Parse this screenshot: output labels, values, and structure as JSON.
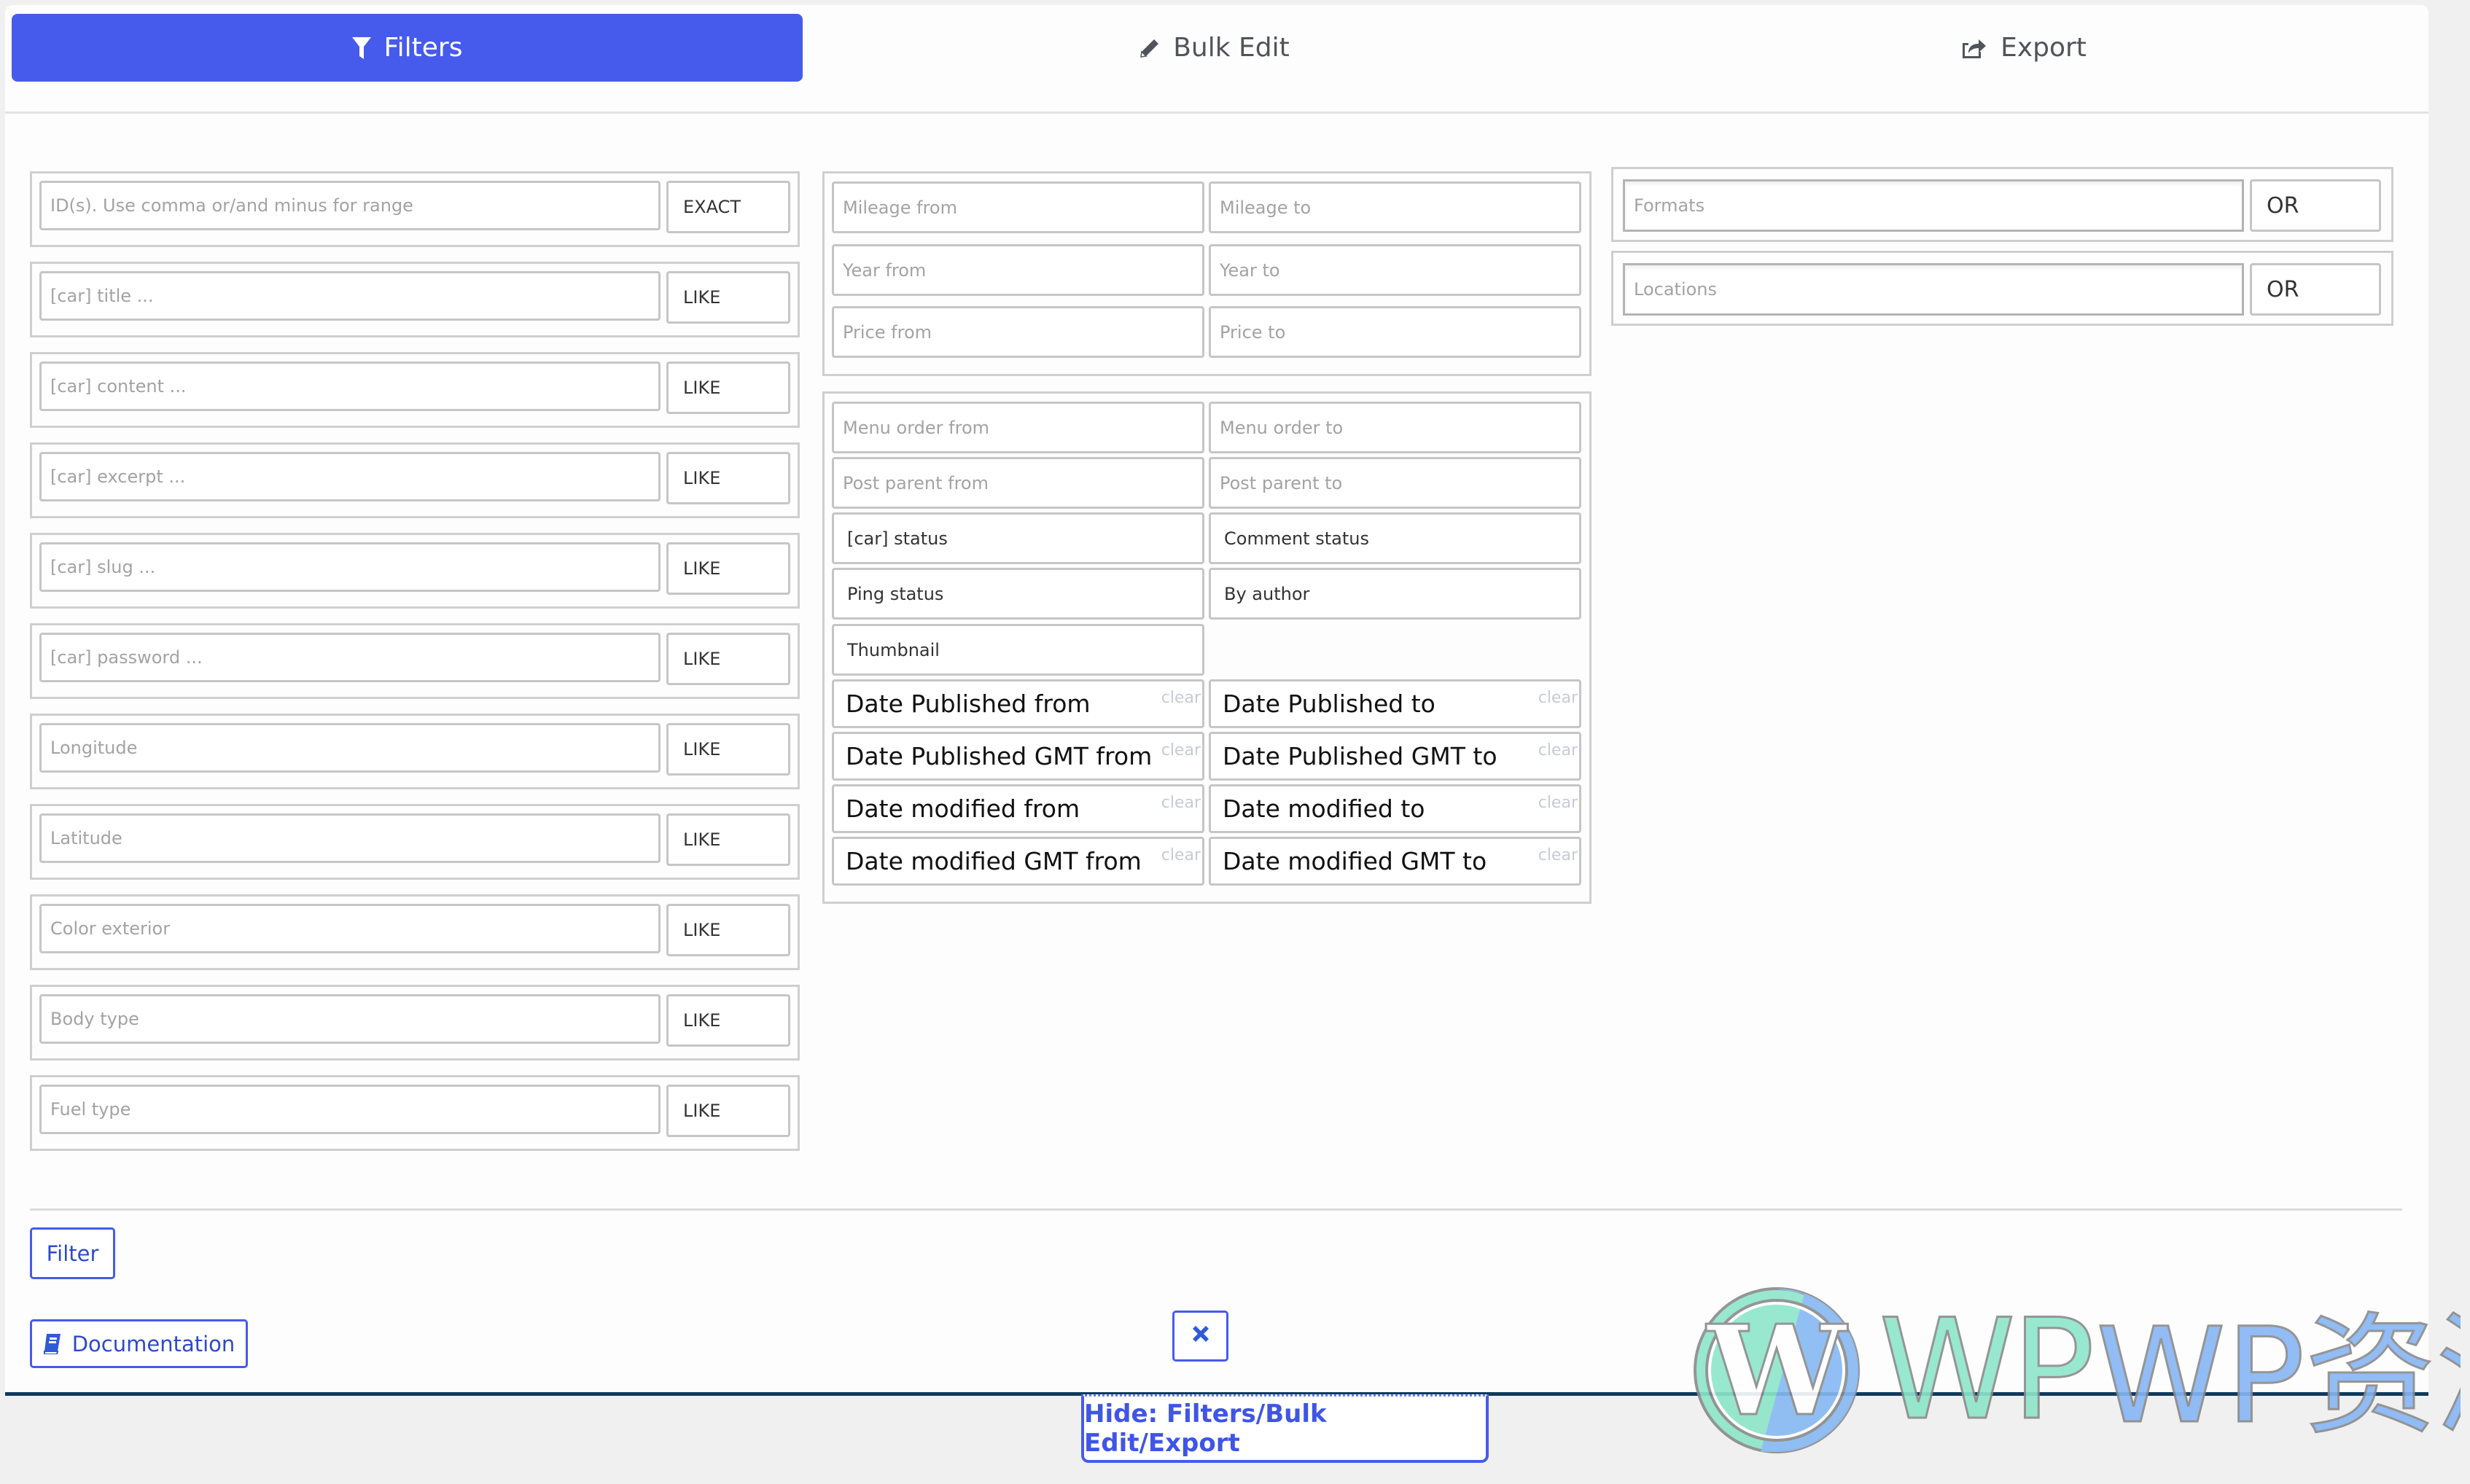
{
  "tabs": {
    "filters": "Filters",
    "bulk_edit": "Bulk Edit",
    "export": "Export"
  },
  "left_filters": [
    {
      "placeholder": "ID(s). Use comma or/and minus for range",
      "operator": "EXACT"
    },
    {
      "placeholder": "[car] title ...",
      "operator": "LIKE"
    },
    {
      "placeholder": "[car] content ...",
      "operator": "LIKE"
    },
    {
      "placeholder": "[car] excerpt ...",
      "operator": "LIKE"
    },
    {
      "placeholder": "[car] slug ...",
      "operator": "LIKE"
    },
    {
      "placeholder": "[car] password ...",
      "operator": "LIKE"
    },
    {
      "placeholder": "Longitude",
      "operator": "LIKE"
    },
    {
      "placeholder": "Latitude",
      "operator": "LIKE"
    },
    {
      "placeholder": "Color exterior",
      "operator": "LIKE"
    },
    {
      "placeholder": "Body type",
      "operator": "LIKE"
    },
    {
      "placeholder": "Fuel type",
      "operator": "LIKE"
    }
  ],
  "ranges": {
    "mileage_from": "Mileage from",
    "mileage_to": "Mileage to",
    "year_from": "Year from",
    "year_to": "Year to",
    "price_from": "Price from",
    "price_to": "Price to"
  },
  "post_fields": {
    "menu_order_from": "Menu order from",
    "menu_order_to": "Menu order to",
    "post_parent_from": "Post parent from",
    "post_parent_to": "Post parent to",
    "car_status": "[car] status",
    "comment_status": "Comment status",
    "ping_status": "Ping status",
    "by_author": "By author",
    "thumbnail": "Thumbnail"
  },
  "dates": [
    {
      "from": "Date Published from",
      "to": "Date Published to"
    },
    {
      "from": "Date Published GMT from",
      "to": "Date Published GMT to"
    },
    {
      "from": "Date modified from",
      "to": "Date modified to"
    },
    {
      "from": "Date modified GMT from",
      "to": "Date modified GMT to"
    }
  ],
  "clear_label": "clear",
  "taxonomies": [
    {
      "placeholder": "Formats",
      "operator": "OR"
    },
    {
      "placeholder": "Locations",
      "operator": "OR"
    }
  ],
  "actions": {
    "filter": "Filter",
    "documentation": "Documentation",
    "hide": "Hide: Filters/Bulk Edit/Export"
  },
  "watermark": {
    "text": "WP资源海"
  },
  "colors": {
    "accent": "#465bec",
    "panel_border": "#0f3a5e"
  }
}
